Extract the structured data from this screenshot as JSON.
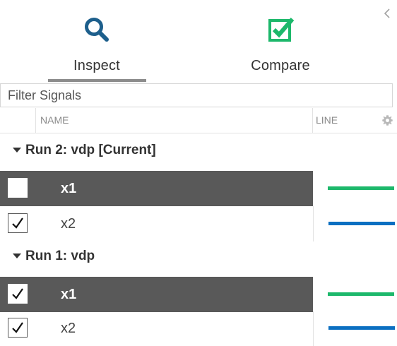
{
  "tabs": {
    "inspect": {
      "label": "Inspect",
      "icon": "magnifier-icon",
      "active": true
    },
    "compare": {
      "label": "Compare",
      "icon": "checkmark-box-icon",
      "active": false
    }
  },
  "filter": {
    "placeholder": "Filter Signals",
    "value": ""
  },
  "table": {
    "headers": {
      "name": "NAME",
      "line": "LINE"
    }
  },
  "runs": [
    {
      "label": "Run 2: vdp [Current]",
      "expanded": true,
      "signals": [
        {
          "name": "x1",
          "checked": false,
          "selected": true,
          "line_color": "#1db86b"
        },
        {
          "name": "x2",
          "checked": true,
          "selected": false,
          "line_color": "#0b6fc1"
        }
      ]
    },
    {
      "label": "Run 1: vdp",
      "expanded": true,
      "signals": [
        {
          "name": "x1",
          "checked": true,
          "selected": true,
          "line_color": "#1db86b"
        },
        {
          "name": "x2",
          "checked": true,
          "selected": false,
          "line_color": "#0b6fc1"
        }
      ]
    }
  ],
  "colors": {
    "accent_blue": "#1d5f8c",
    "accent_green": "#1db86b",
    "selected_row": "#595959",
    "tab_underline": "#8c8c8c"
  }
}
